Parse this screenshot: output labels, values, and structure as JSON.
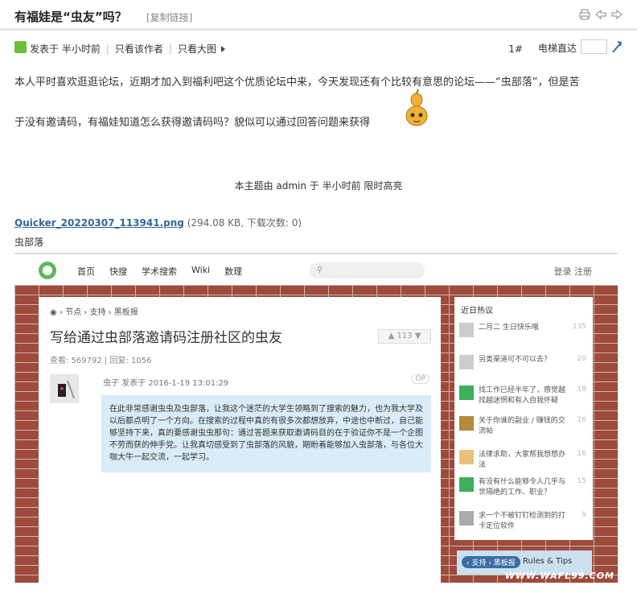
{
  "header": {
    "title": "有福娃是“虫友”吗？",
    "copy_link": "[复制链接]"
  },
  "postbar": {
    "posted": "发表于 半小时前",
    "author_only": "只看该作者",
    "big_image": "只看大图",
    "floor": "1#",
    "elevator": "电梯直达"
  },
  "content": {
    "line1": "本人平时喜欢逛逛论坛，近期才加入到福利吧这个优质论坛中来，今天发现还有个比较有意思的论坛——“虫部落”，但是苦",
    "line2": "于没有邀请码，有福娃知道怎么获得邀请码吗？貌似可以通过回答问题来获得",
    "highlight_note": "本主题由 admin 于 半小时前 限时高亮"
  },
  "attachment": {
    "filename": "Quicker_20220307_113941.png",
    "meta": "(294.08 KB, 下载次数: 0)",
    "caption": "虫部落"
  },
  "screenshot": {
    "nav": [
      "首页",
      "快搜",
      "学术搜索",
      "Wiki",
      "数理"
    ],
    "login": "登录 注册",
    "crumbs": "◉ › 节点 › 支持 › 黑板报",
    "post_title": "写给通过虫部落邀请码注册社区的虫友",
    "votes": "▲ 113  ▼",
    "stats": "查看: 569792 | 回复: 1056",
    "post_info": "虫子 发表于 2016-1-19 13:01:29",
    "op": "OP",
    "quote": "在此非常感谢虫虫及虫部落，让我这个迷茫的大学生领略到了搜索的魅力，也为我大学及以后都点明了一个方向。在搜索的过程中真的有很多次都想放弃，中途也中断过，自己能够坚持下来，真的要感谢虫虫那句：通过答题来获取邀请码目的在于验证你不是一个企图不劳而获的伸手党。让我真切感受到了虫部落的风貌，期盼着能够加入虫部落，与各位大咖大牛一起交流，一起学习。",
    "side_title": "近日热议",
    "side_items": [
      {
        "text": "二月二 生日快乐哦",
        "count": "135"
      },
      {
        "text": "另类渠道可不可以去？",
        "count": "20"
      },
      {
        "text": "找工作已经半年了，感觉越找越迷惘和有入自我怀疑",
        "count": "18"
      },
      {
        "text": "关于你谁的副业 / 赚钱的交流帖",
        "count": "16"
      },
      {
        "text": "法律求助，大家帮我想想办法",
        "count": "16"
      },
      {
        "text": "有没有什么能够令人几乎与世隔绝的工作、职业？",
        "count": "15"
      },
      {
        "text": "求一个不被钉钉检测到的打卡定位软件",
        "count": "9"
      }
    ],
    "bottom_tag": "‹ 支持 › 黑板报",
    "rules": "Rules & Tips",
    "watermark": "WWW.WAFL99.COM"
  },
  "colors": {
    "accent_green": "#6cbf3a",
    "link_blue": "#336699",
    "quote_bg": "#d9ecf7"
  }
}
